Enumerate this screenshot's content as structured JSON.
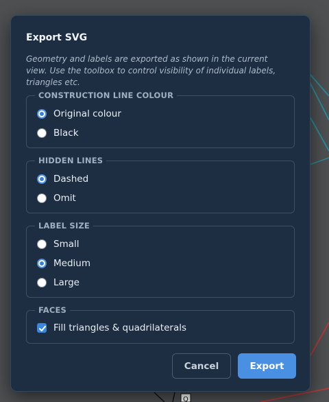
{
  "dialog": {
    "title": "Export SVG",
    "description": "Geometry and labels are exported as shown in the current view. Use the toolbox to control visibility of individual labels, triangles etc."
  },
  "construction_line_colour": {
    "legend": "CONSTRUCTION LINE COLOUR",
    "options": [
      {
        "label": "Original colour",
        "checked": true
      },
      {
        "label": "Black",
        "checked": false
      }
    ]
  },
  "hidden_lines": {
    "legend": "HIDDEN LINES",
    "options": [
      {
        "label": "Dashed",
        "checked": true
      },
      {
        "label": "Omit",
        "checked": false
      }
    ]
  },
  "label_size": {
    "legend": "LABEL SIZE",
    "options": [
      {
        "label": "Small",
        "checked": false
      },
      {
        "label": "Medium",
        "checked": true
      },
      {
        "label": "Large",
        "checked": false
      }
    ]
  },
  "faces": {
    "legend": "FACES",
    "fill_label": "Fill triangles & quadrilaterals",
    "fill_checked": true
  },
  "buttons": {
    "cancel": "Cancel",
    "export": "Export"
  },
  "background": {
    "peek_label": "Q"
  },
  "colors": {
    "dialog_bg": "#1d2e42",
    "accent": "#4a90e2",
    "backdrop": "#4e5052"
  }
}
